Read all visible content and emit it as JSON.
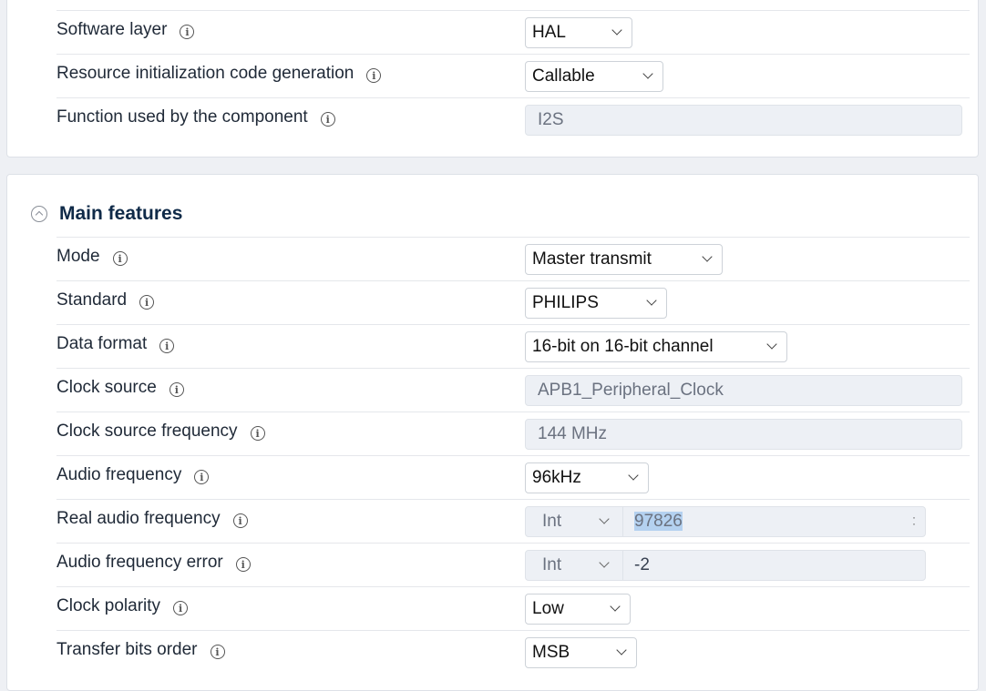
{
  "top_section": {
    "rows": [
      {
        "label": "Software layer",
        "value": "HAL"
      },
      {
        "label": "Resource initialization code generation",
        "value": "Callable"
      },
      {
        "label": "Function used by the component",
        "value": "I2S"
      }
    ]
  },
  "main_features": {
    "title": "Main features",
    "mode": {
      "label": "Mode",
      "value": "Master transmit"
    },
    "standard": {
      "label": "Standard",
      "value": "PHILIPS"
    },
    "data_format": {
      "label": "Data format",
      "value": "16-bit on 16-bit channel"
    },
    "clock_source": {
      "label": "Clock source",
      "value": "APB1_Peripheral_Clock"
    },
    "clock_source_frequency": {
      "label": "Clock source frequency",
      "value": "144 MHz"
    },
    "audio_frequency": {
      "label": "Audio frequency",
      "value": "96kHz"
    },
    "real_audio_frequency": {
      "label": "Real audio frequency",
      "type": "Int",
      "value": "97826"
    },
    "audio_frequency_error": {
      "label": "Audio frequency error",
      "type": "Int",
      "value": "-2"
    },
    "clock_polarity": {
      "label": "Clock polarity",
      "value": "Low"
    },
    "transfer_bits_order": {
      "label": "Transfer bits order",
      "value": "MSB"
    }
  },
  "icons": {
    "info": "info-circle-icon",
    "dropdown": "chevron-down-icon",
    "collapse": "chevron-up-circle-icon"
  },
  "colors": {
    "title": "#0f2a48",
    "readonly_bg": "#edf0f5",
    "highlight": "#b4d1f0"
  }
}
